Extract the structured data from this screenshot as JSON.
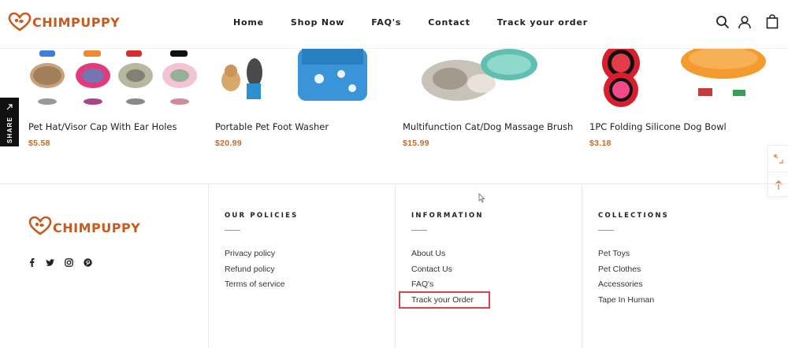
{
  "header": {
    "logo_text": "CHIMPUPPY",
    "nav": [
      "Home",
      "Shop Now",
      "FAQ's",
      "Contact",
      "Track your order"
    ],
    "icons": [
      "search-icon",
      "user-icon",
      "bag-icon"
    ]
  },
  "share": {
    "label": "SHARE",
    "icon": "share-icon"
  },
  "products": [
    {
      "name": "Pet Hat/Visor Cap With Ear Holes",
      "price": "$5.58",
      "swatches": [
        "Blue",
        "Orange",
        "Red",
        "Black"
      ]
    },
    {
      "name": "Portable Pet Foot Washer",
      "price": "$20.99"
    },
    {
      "name": "Multifunction Cat/Dog Massage Brush",
      "price": "$15.99"
    },
    {
      "name": "1PC Folding Silicone Dog Bowl",
      "price": "$3.18"
    }
  ],
  "float_widget": {
    "icons": [
      "resize-icon",
      "arrow-up-icon"
    ]
  },
  "footer": {
    "logo_text": "CHIMPUPPY",
    "social": [
      "facebook-icon",
      "twitter-icon",
      "instagram-icon",
      "pinterest-icon"
    ],
    "policies": {
      "heading": "OUR POLICIES",
      "links": [
        "Privacy policy",
        "Refund policy",
        "Terms of service"
      ]
    },
    "information": {
      "heading": "INFORMATION",
      "links": [
        "About Us",
        "Contact Us",
        "FAQ's",
        "Track your Order"
      ]
    },
    "collections": {
      "heading": "COLLECTIONS",
      "links": [
        "Pet Toys",
        "Pet Clothes",
        "Accessories",
        "Tape In Human"
      ]
    }
  },
  "colors": {
    "brand": "#c85a1e",
    "price": "#c26a2c",
    "highlight": "#d9434a"
  }
}
